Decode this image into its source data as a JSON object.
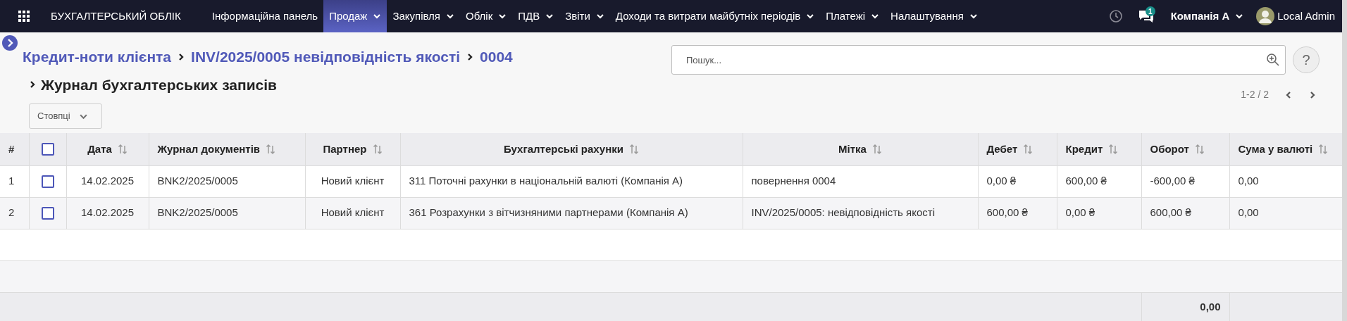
{
  "navbar": {
    "brand": "БУХГАЛТЕРСЬКИЙ ОБЛІК",
    "menu": [
      {
        "label": "Інформаційна панель",
        "selected": false,
        "dropdown": false
      },
      {
        "label": "Продаж",
        "selected": true,
        "dropdown": true
      },
      {
        "label": "Закупівля",
        "selected": false,
        "dropdown": true
      },
      {
        "label": "Облік",
        "selected": false,
        "dropdown": true
      },
      {
        "label": "ПДВ",
        "selected": false,
        "dropdown": true
      },
      {
        "label": "Звіти",
        "selected": false,
        "dropdown": true
      },
      {
        "label": "Доходи та витрати майбутніх періодів",
        "selected": false,
        "dropdown": true
      },
      {
        "label": "Платежі",
        "selected": false,
        "dropdown": true
      },
      {
        "label": "Налаштування",
        "selected": false,
        "dropdown": true
      }
    ],
    "messages_badge": "1",
    "company": "Компанія А",
    "user": "Local Admin"
  },
  "breadcrumbs": [
    "Кредит-ноти клієнта",
    "INV/2025/0005 невідповідність якості",
    "0004"
  ],
  "title": "Журнал бухгалтерських записів",
  "columns_button": "Стовпці",
  "search": {
    "placeholder": "Пошук..."
  },
  "help": "?",
  "pager": "1-2 / 2",
  "table": {
    "columns": [
      {
        "label": "#",
        "sortable": false
      },
      {
        "label": "Дата",
        "sortable": true
      },
      {
        "label": "Журнал документів",
        "sortable": true
      },
      {
        "label": "Партнер",
        "sortable": true
      },
      {
        "label": "Бухгалтерські рахунки",
        "sortable": true
      },
      {
        "label": "Мітка",
        "sortable": true
      },
      {
        "label": "Дебет",
        "sortable": true
      },
      {
        "label": "Кредит",
        "sortable": true
      },
      {
        "label": "Оборот",
        "sortable": true
      },
      {
        "label": "Сума у валюті",
        "sortable": true
      }
    ],
    "all_checked": false,
    "rows": [
      {
        "checked": false,
        "cells": [
          "1",
          "14.02.2025",
          "BNK2/2025/0005",
          "Новий клієнт",
          "311 Поточні рахунки в національній валюті (Компанія А)",
          "повернення 0004",
          "0,00 ₴",
          "600,00 ₴",
          "-600,00 ₴",
          "0,00"
        ]
      },
      {
        "checked": false,
        "cells": [
          "2",
          "14.02.2025",
          "BNK2/2025/0005",
          "Новий клієнт",
          "361 Розрахунки з вітчизняними партнерами (Компанія А)",
          "INV/2025/0005: невідповідність якості",
          "600,00 ₴",
          "0,00 ₴",
          "600,00 ₴",
          "0,00"
        ]
      }
    ],
    "totals": {
      "turnover": "0,00"
    }
  }
}
